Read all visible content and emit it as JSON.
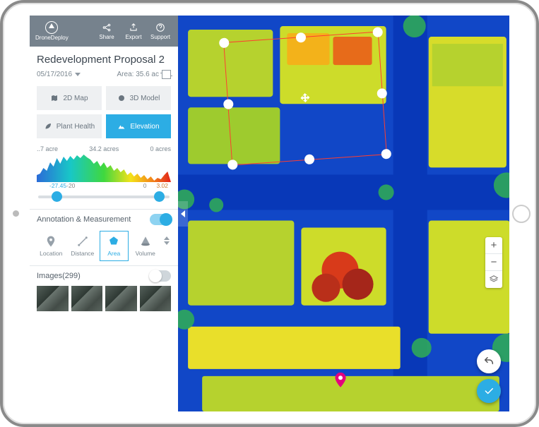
{
  "brand": "DroneDeploy",
  "header": {
    "share": "Share",
    "export": "Export",
    "support": "Support"
  },
  "project": {
    "title": "Redevelopment Proposal 2",
    "date": "05/17/2016",
    "area_label": "Area: 35.6 ac"
  },
  "views": {
    "map2d": "2D Map",
    "model3d": "3D Model",
    "plant": "Plant Health",
    "elevation": "Elevation",
    "active": "elevation"
  },
  "elevation_scale": {
    "left": "..7 acre",
    "mid": "34.2 acres",
    "right": "0 acres"
  },
  "range": {
    "min_label": "-27.45",
    "mid_label": "-20",
    "zero_label": "0",
    "max_label": "3.02"
  },
  "annotation": {
    "heading": "Annotation & Measurement",
    "enabled": true,
    "tools": {
      "location": "Location",
      "distance": "Distance",
      "area": "Area",
      "volume": "Volume"
    },
    "active": "area"
  },
  "images": {
    "label": "Images",
    "count": 299,
    "visible": false
  },
  "map_controls": {
    "zoom_in": "+",
    "zoom_out": "−",
    "layers": "≡"
  },
  "colors": {
    "accent": "#2cade4",
    "selection": "#ff3e30",
    "pin": "#e4007f"
  }
}
